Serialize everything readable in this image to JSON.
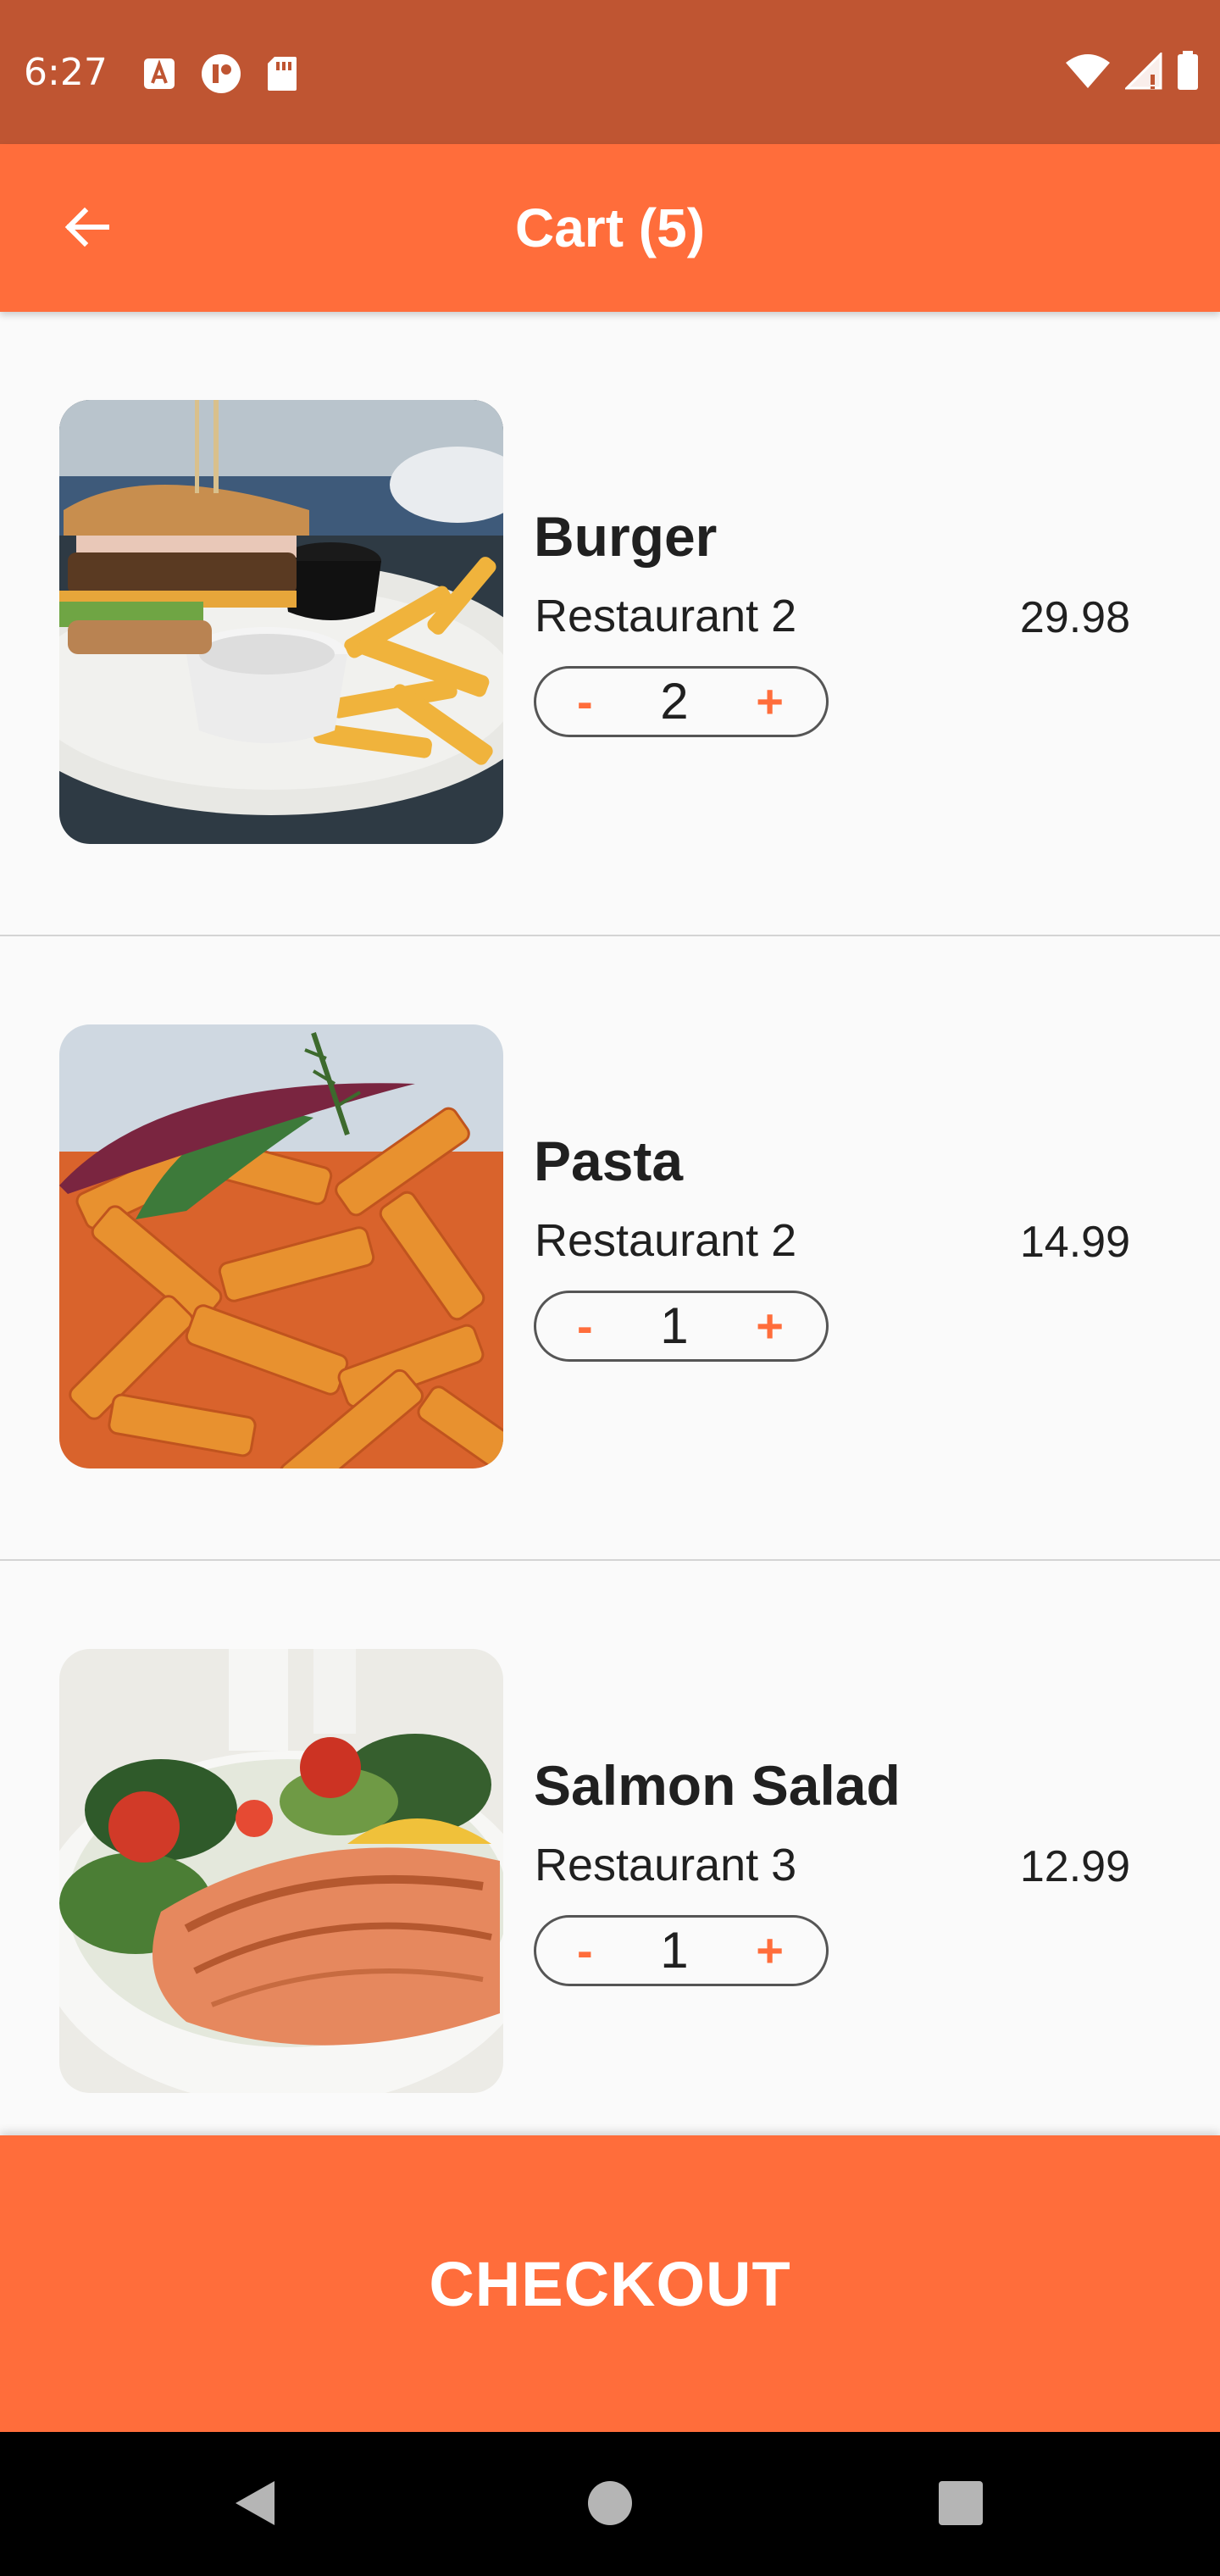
{
  "status_bar": {
    "time": "6:27",
    "icons_left": [
      "keyboard-a-icon",
      "media-icon",
      "sd-card-icon"
    ],
    "icons_right": [
      "wifi-icon",
      "signal-icon",
      "battery-icon"
    ]
  },
  "app_bar": {
    "title": "Cart (5)",
    "back_icon": "arrow-left-icon"
  },
  "cart": {
    "items": [
      {
        "name": "Burger",
        "restaurant": "Restaurant 2",
        "price": "29.98",
        "quantity": "2",
        "minus_label": "-",
        "plus_label": "+"
      },
      {
        "name": "Pasta",
        "restaurant": "Restaurant 2",
        "price": "14.99",
        "quantity": "1",
        "minus_label": "-",
        "plus_label": "+"
      },
      {
        "name": "Salmon Salad",
        "restaurant": "Restaurant 3",
        "price": "12.99",
        "quantity": "1",
        "minus_label": "-",
        "plus_label": "+"
      }
    ]
  },
  "checkout": {
    "label": "CHECKOUT"
  },
  "colors": {
    "status_bar": "#bf5532",
    "accent": "#ff6d3b",
    "background": "#fafafa",
    "text": "#202020"
  }
}
